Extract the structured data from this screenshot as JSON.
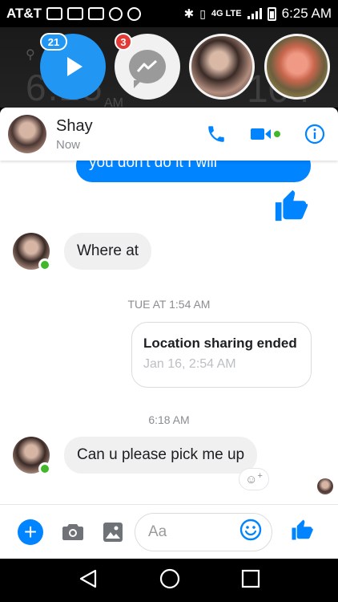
{
  "status_bar": {
    "carrier": "AT&T",
    "network": "4G LTE",
    "time": "6:25 AM"
  },
  "wallpaper": {
    "clock": "6:25",
    "ampm": "AM",
    "temp": "104"
  },
  "chat_heads": {
    "play_badge": "21",
    "messenger_badge": "3"
  },
  "header": {
    "contact_name": "Shay",
    "status": "Now"
  },
  "messages": {
    "partial_outgoing": "you don't do it I will",
    "incoming_1": "Where at",
    "timestamp_1": "TUE AT 1:54 AM",
    "location_title": "Location sharing ended",
    "location_subtitle": "Jan 16, 2:54 AM",
    "timestamp_2": "6:18 AM",
    "incoming_2": "Can u please pick me up"
  },
  "composer": {
    "placeholder": "Aa"
  },
  "colors": {
    "accent": "#0084ff",
    "online": "#42b72a",
    "badge_red": "#e53935",
    "chat_head_blue": "#2196f3"
  },
  "icons": [
    "play-icon",
    "messenger-icon",
    "phone-icon",
    "video-icon",
    "info-icon",
    "like-icon",
    "add-icon",
    "camera-icon",
    "gallery-icon",
    "emoji-icon",
    "back-icon",
    "home-icon",
    "recents-icon"
  ]
}
